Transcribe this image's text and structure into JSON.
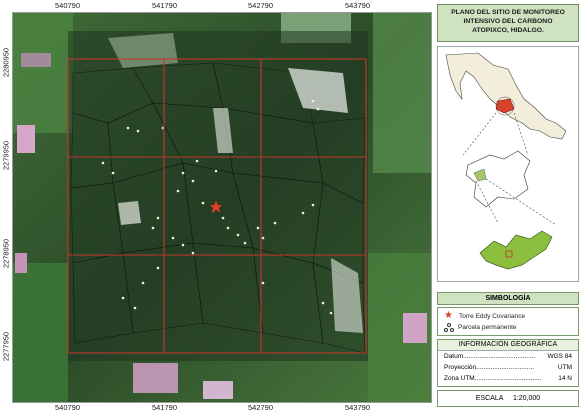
{
  "map": {
    "x_ticks": [
      "540790",
      "541790",
      "542790",
      "543790"
    ],
    "x_ticks_bottom": [
      "540790",
      "541790",
      "542790",
      "543790"
    ],
    "y_ticks": [
      "2280950",
      "2279950",
      "2278950",
      "2277950"
    ]
  },
  "title": {
    "line1": "PLANO DEL SITIO DE MONITOREO",
    "line2": "INTENSIVO DEL CARBONO",
    "line3": "ATOPIXCO, HIDALGO."
  },
  "legend": {
    "heading": "SIMBOLOGÍA",
    "items": [
      {
        "label": "Torre Eddy Covariance",
        "icon": "star-icon",
        "color": "#d8432a"
      },
      {
        "label": "Parcela permanente",
        "icon": "plot-dots-icon",
        "color": "#ffffff"
      }
    ]
  },
  "info": {
    "heading": "INFORMACIÓN GEOGRÁFICA",
    "rows": [
      {
        "label": "Datum",
        "dots": "........................................",
        "value": "WGS 84"
      },
      {
        "label": "Proyección",
        "dots": "................................",
        "value": "UTM"
      },
      {
        "label": "Zona UTM",
        "dots": ".....................................",
        "value": "14 N"
      }
    ]
  },
  "scale": {
    "label": "ESCALA",
    "value": "1:20,000"
  },
  "colors": {
    "grid_line": "#c0392b",
    "title_bg": "#cfe3c2",
    "mexico_fill": "#f3eddc",
    "highlight_state": "#d8432a",
    "hidalgo_fill": "#a6c86a"
  }
}
